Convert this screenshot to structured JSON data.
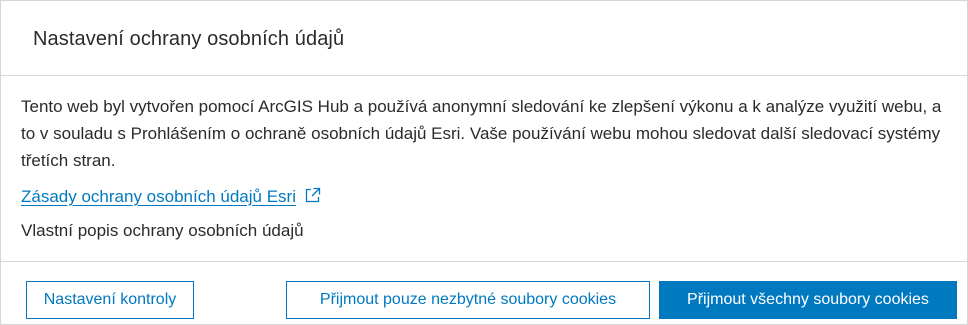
{
  "dialog": {
    "title": "Nastavení ochrany osobních údajů",
    "description": "Tento web byl vytvořen pomocí ArcGIS Hub a používá anonymní sledování ke zlepšení výkonu a k analýze využití webu, a to v souladu s Prohlášením o ochraně osobních údajů Esri. Vaše používání webu mohou sledovat další sledovací systémy třetích stran.",
    "policy_link": "Zásady ochrany osobních údajů Esri",
    "custom_text": "Vlastní popis ochrany osobních údajů"
  },
  "buttons": {
    "settings": "Nastavení kontroly",
    "necessary": "Přijmout pouze nezbytné soubory cookies",
    "accept_all": "Přijmout všechny soubory cookies"
  },
  "colors": {
    "accent": "#0079c1",
    "border": "#d6d6d6",
    "text": "#2b2b2b"
  },
  "icons": {
    "policy_link_icon": "external-link-icon"
  }
}
